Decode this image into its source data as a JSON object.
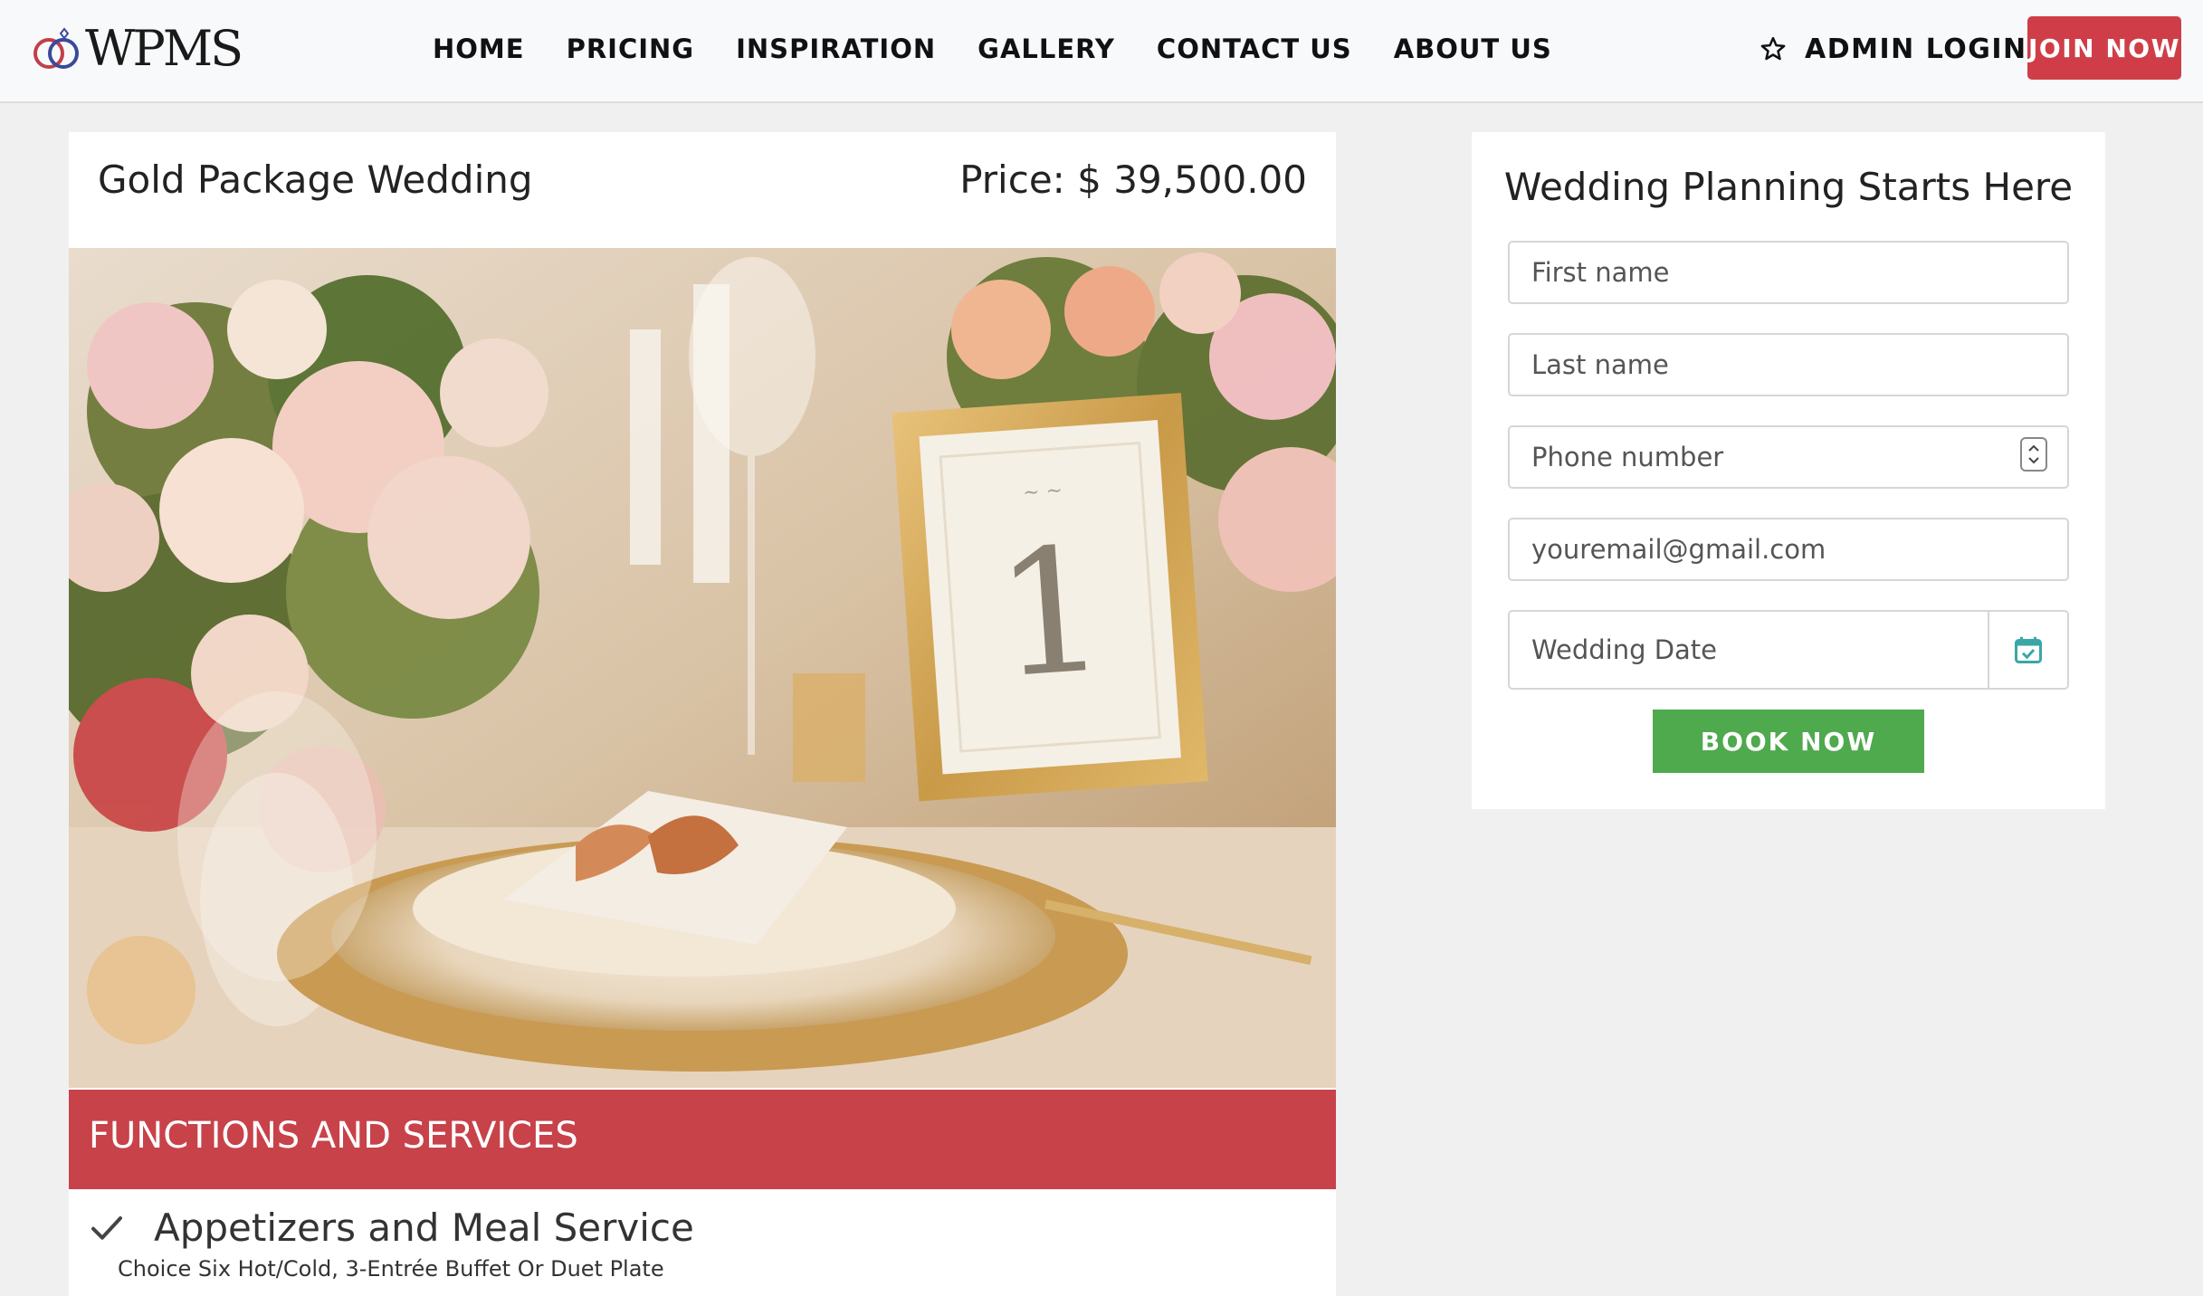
{
  "brand": {
    "name": "WPMS",
    "logo_icon": "wedding-rings-icon"
  },
  "nav": {
    "items": [
      {
        "label": "HOME"
      },
      {
        "label": "PRICING"
      },
      {
        "label": "INSPIRATION"
      },
      {
        "label": "GALLERY"
      },
      {
        "label": "CONTACT US"
      },
      {
        "label": "ABOUT US"
      }
    ],
    "admin_icon": "star-outline-icon",
    "admin_login": "ADMIN LOGIN",
    "join_now": "JOIN NOW"
  },
  "package": {
    "title": "Gold Package Wedding",
    "price": "Price: $ 39,500.00",
    "image_content": "table-number-1",
    "section_title": "FUNCTIONS AND SERVICES",
    "services": [
      {
        "icon": "check-icon",
        "name": "Appetizers and Meal Service",
        "description": "Choice Six Hot/Cold, 3-Entrée Buffet Or Duet Plate"
      }
    ]
  },
  "form": {
    "title": "Wedding Planning Starts Here",
    "first_name_placeholder": "First name",
    "last_name_placeholder": "Last name",
    "phone_placeholder": "Phone number",
    "email_placeholder": "youremail@gmail.com",
    "date_placeholder": "Wedding Date",
    "date_icon": "calendar-check-icon",
    "submit_label": "BOOK NOW"
  },
  "colors": {
    "join_button": "#cf3e48",
    "services_bar": "#c8424a",
    "book_button": "#4fa94d",
    "calendar_icon": "#3aa6a6",
    "background": "#f0f0f0"
  }
}
